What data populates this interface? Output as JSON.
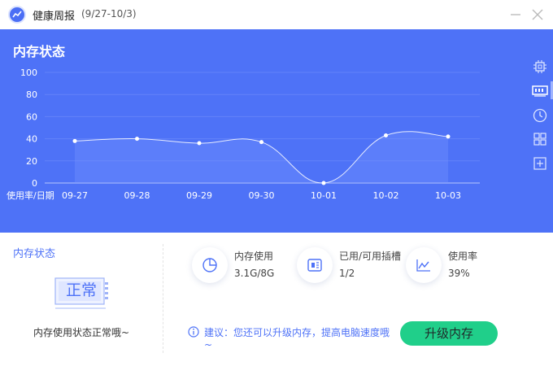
{
  "window": {
    "title": "健康周报",
    "date_range": "(9/27-10/3)"
  },
  "panel": {
    "title": "内存状态"
  },
  "chart_data": {
    "type": "line",
    "title": "内存状态",
    "xlabel": "使用率/日期",
    "ylabel": "",
    "categories": [
      "09-27",
      "09-28",
      "09-29",
      "09-30",
      "10-01",
      "10-02",
      "10-03"
    ],
    "values": [
      38,
      40,
      36,
      37,
      0,
      43,
      42
    ],
    "ylim": [
      0,
      100
    ],
    "yticks": [
      0,
      20,
      40,
      60,
      80,
      100
    ],
    "grid": true,
    "line_color": "#ffffff"
  },
  "side_icons": [
    "cpu-icon",
    "memory-icon",
    "clock-icon",
    "grid-icon",
    "plus-box-icon"
  ],
  "left_card": {
    "title": "内存状态",
    "badge": "正常",
    "status": "内存使用状态正常哦~"
  },
  "stats": [
    {
      "icon": "pie-icon",
      "label": "内存使用",
      "value": "3.1G/8G"
    },
    {
      "icon": "memory-slot-icon",
      "label": "已用/可用插槽",
      "value": "1/2"
    },
    {
      "icon": "trend-icon",
      "label": "使用率",
      "value": "39%"
    }
  ],
  "tip": {
    "text": "建议：您还可以升级内存，提高电脑速度哦~"
  },
  "upgrade_button": {
    "label": "升级内存"
  },
  "colors": {
    "brand_blue": "#4e72f7",
    "green": "#20cf8a"
  }
}
